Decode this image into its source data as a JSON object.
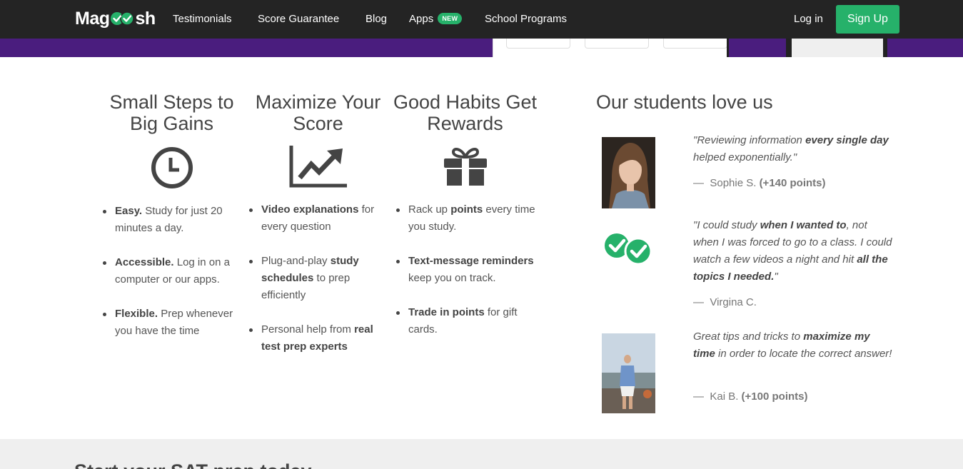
{
  "nav": {
    "logo": {
      "before": "Mag",
      "after": "sh"
    },
    "links": [
      {
        "label": "Testimonials"
      },
      {
        "label": "Score Guarantee"
      },
      {
        "label": "Blog"
      },
      {
        "label": "Apps",
        "badge": "NEW"
      },
      {
        "label": "School Programs"
      }
    ],
    "login_label": "Log in",
    "signup_label": "Sign Up"
  },
  "features": [
    {
      "title": "Small Steps to Big Gains",
      "icon": "clock-icon",
      "items": [
        {
          "bold": "Easy.",
          "rest": " Study for just 20 minutes a day."
        },
        {
          "bold": "Accessible.",
          "rest": " Log in on a computer or our apps."
        },
        {
          "bold": "Flexible.",
          "rest": " Prep whenever you have the time"
        }
      ]
    },
    {
      "title": "Maximize Your Score",
      "icon": "chart-trend-up-icon",
      "items": [
        {
          "parts": [
            {
              "b": "Video explanations"
            },
            {
              "t": " for every question"
            }
          ]
        },
        {
          "parts": [
            {
              "t": "Plug-and-play "
            },
            {
              "b": "study schedules"
            },
            {
              "t": " to prep efficiently"
            }
          ]
        },
        {
          "parts": [
            {
              "t": "Personal help from "
            },
            {
              "b": "real test prep experts"
            }
          ]
        }
      ]
    },
    {
      "title": "Good Habits Get Rewards",
      "icon": "gift-icon",
      "items": [
        {
          "parts": [
            {
              "t": "Rack up "
            },
            {
              "b": "points"
            },
            {
              "t": " every time you study."
            }
          ]
        },
        {
          "parts": [
            {
              "b": "Text-message reminders"
            },
            {
              "t": " keep you on track."
            }
          ]
        },
        {
          "parts": [
            {
              "b": "Trade in points"
            },
            {
              "t": " for gift cards."
            }
          ]
        }
      ]
    }
  ],
  "testimonials": {
    "heading": "Our students love us",
    "items": [
      {
        "photo": "student-photo-sophie",
        "quote_parts": [
          {
            "t": "\"Reviewing information "
          },
          {
            "b": "every single day"
          },
          {
            "t": " helped exponentially.\""
          }
        ],
        "author": "Sophie S.",
        "points": "(+140 points)"
      },
      {
        "photo": "magoosh-checks-logo",
        "quote_parts": [
          {
            "t": "\"I could study "
          },
          {
            "b": "when I wanted to"
          },
          {
            "t": ", not when I was forced to go to a class. I could watch a few videos a night and hit "
          },
          {
            "b": "all the topics I needed."
          },
          {
            "t": "\""
          }
        ],
        "author": "Virgina C.",
        "points": ""
      },
      {
        "photo": "student-photo-kai",
        "quote_parts": [
          {
            "t": "Great tips and tricks to "
          },
          {
            "b": "maximize my time"
          },
          {
            "t": " in order to locate the correct answer!"
          }
        ],
        "author": "Kai B.",
        "points": "(+100 points)"
      }
    ],
    "author_dash": "—"
  },
  "bottom": {
    "heading": "Start your SAT prep today"
  },
  "colors": {
    "nav_bg": "#242424",
    "brand_green": "#26b16a",
    "hero_purple": "#4a1d7e",
    "text": "#444444"
  }
}
